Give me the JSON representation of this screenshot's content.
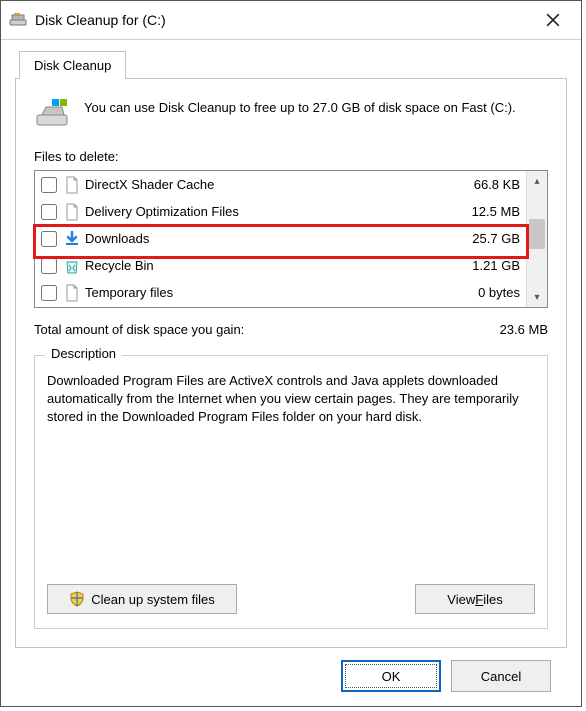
{
  "window": {
    "title": "Disk Cleanup for  (C:)"
  },
  "tab_label": "Disk Cleanup",
  "intro_text": "You can use Disk Cleanup to free up to 27.0 GB of disk space on Fast (C:).",
  "files_heading": "Files to delete:",
  "items": [
    {
      "name": "DirectX Shader Cache",
      "size": "66.8 KB",
      "icon": "file"
    },
    {
      "name": "Delivery Optimization Files",
      "size": "12.5 MB",
      "icon": "file"
    },
    {
      "name": "Downloads",
      "size": "25.7 GB",
      "icon": "download"
    },
    {
      "name": "Recycle Bin",
      "size": "1.21 GB",
      "icon": "recycle"
    },
    {
      "name": "Temporary files",
      "size": "0 bytes",
      "icon": "file"
    }
  ],
  "total_label": "Total amount of disk space you gain:",
  "total_value": "23.6 MB",
  "description": {
    "legend": "Description",
    "text": "Downloaded Program Files are ActiveX controls and Java applets downloaded automatically from the Internet when you view certain pages. They are temporarily stored in the Downloaded Program Files folder on your hard disk."
  },
  "buttons": {
    "clean_up": "Clean up system files",
    "view_files_prefix": "View ",
    "view_files_u": "F",
    "view_files_suffix": "iles",
    "ok": "OK",
    "cancel": "Cancel"
  }
}
